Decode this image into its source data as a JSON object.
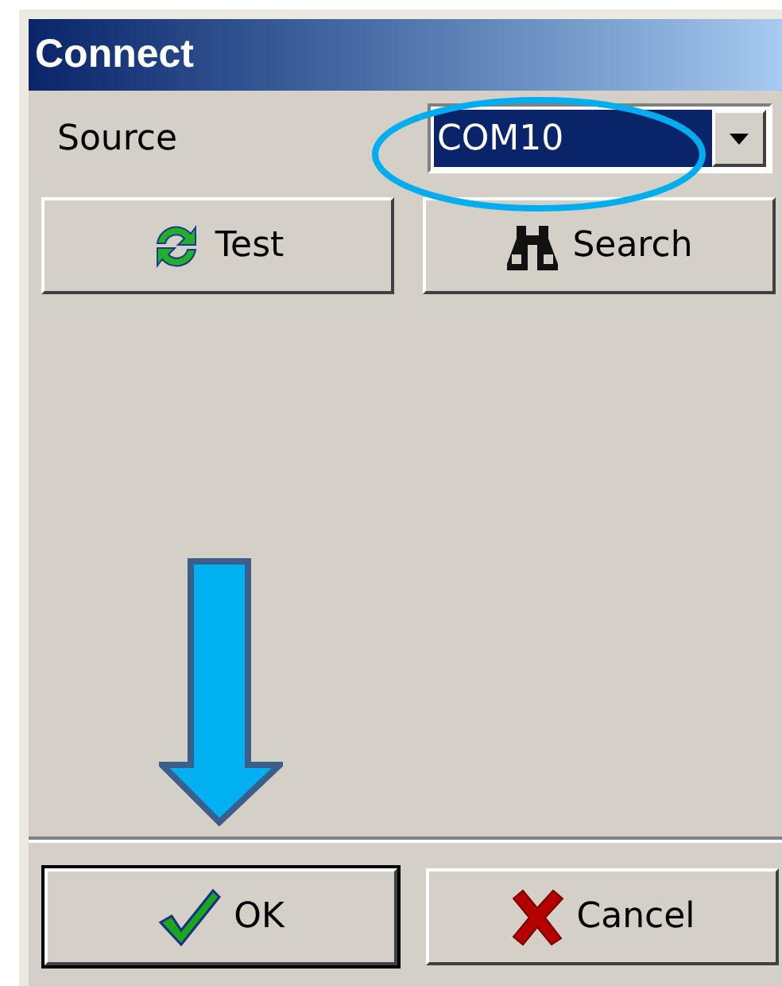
{
  "window": {
    "title": "Connect"
  },
  "source": {
    "label": "Source",
    "value": "COM10",
    "focused": true
  },
  "buttons": [
    {
      "kind": "test",
      "label": "Test",
      "default": false
    },
    {
      "kind": "search",
      "label": "Search",
      "default": false
    }
  ],
  "footer_buttons": [
    {
      "kind": "ok",
      "label": "OK",
      "default": true
    },
    {
      "kind": "cancel",
      "label": "Cancel",
      "default": false
    }
  ]
}
